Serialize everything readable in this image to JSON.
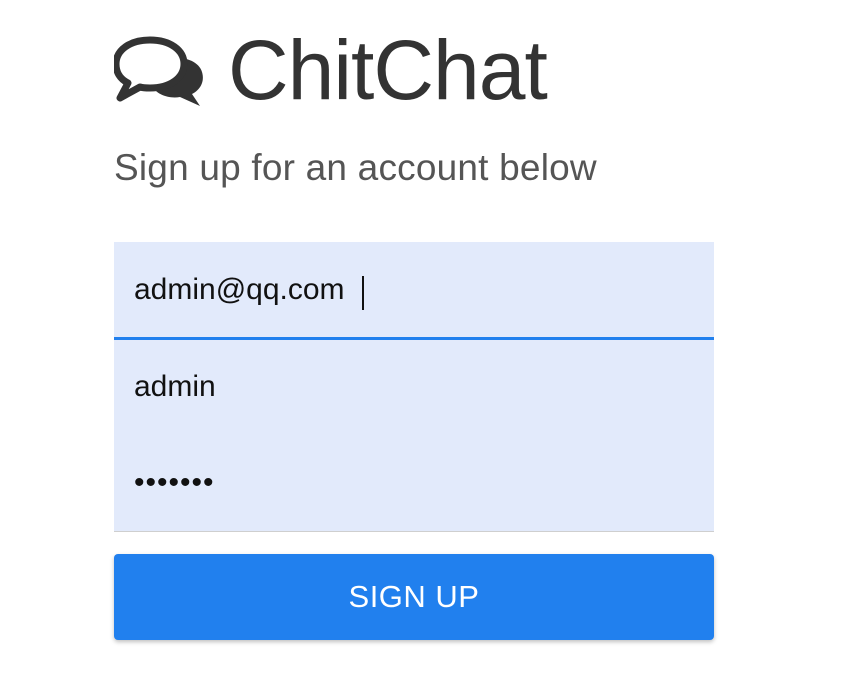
{
  "brand": {
    "name": "ChitChat",
    "icon": "comments-icon"
  },
  "subtitle": "Sign up for an account below",
  "form": {
    "email": {
      "value": "admin@qq.com",
      "focused": true
    },
    "username": {
      "value": "admin"
    },
    "password": {
      "value": "1234567"
    }
  },
  "button": {
    "label": "SIGN UP"
  },
  "colors": {
    "accent": "#2180ee",
    "field_bg": "#e2eafb",
    "brand_text": "#333333",
    "subtitle_text": "#555555"
  }
}
